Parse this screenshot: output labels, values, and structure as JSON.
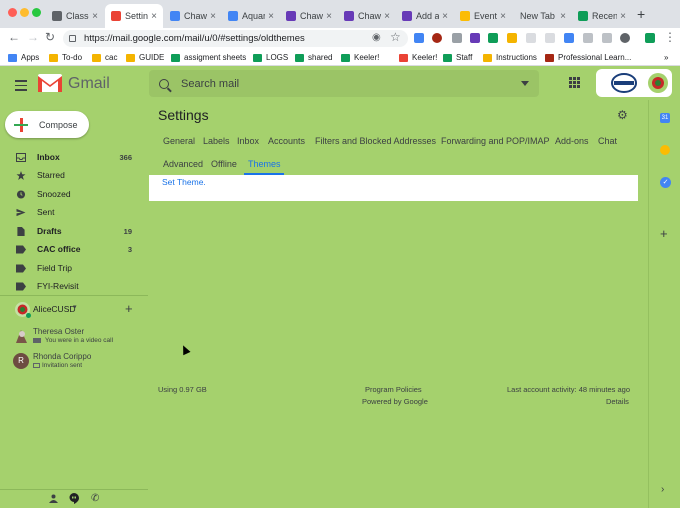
{
  "browser": {
    "tabs": [
      {
        "label": "Classes",
        "icon": "google-classroom-icon",
        "color": "#5f6368"
      },
      {
        "label": "Settings",
        "icon": "gmail-icon",
        "color": "#ea4335",
        "active": true
      },
      {
        "label": "Chawa",
        "icon": "calendar-icon",
        "color": "#4285f4"
      },
      {
        "label": "Aquar",
        "icon": "docs-icon",
        "color": "#4285f4"
      },
      {
        "label": "Chawa",
        "icon": "forms-icon",
        "color": "#673ab7"
      },
      {
        "label": "Chawa",
        "icon": "forms-icon",
        "color": "#673ab7"
      },
      {
        "label": "Add a",
        "icon": "forms-icon",
        "color": "#673ab7"
      },
      {
        "label": "Events",
        "icon": "pen-icon",
        "color": "#fbbc04"
      },
      {
        "label": "New Tab",
        "icon": "",
        "color": ""
      },
      {
        "label": "Recen",
        "icon": "drive-icon",
        "color": "#0f9d58"
      }
    ],
    "url": "https://mail.google.com/mail/u/0/#settings/oldthemes",
    "bookmarks": [
      {
        "label": "Apps",
        "color": "#4285f4"
      },
      {
        "label": "To-do",
        "color": "#f4b400"
      },
      {
        "label": "cac",
        "color": "#f4b400"
      },
      {
        "label": "GUIDE",
        "color": "#f4b400"
      },
      {
        "label": "assigment sheets",
        "color": "#0f9d58"
      },
      {
        "label": "LOGS",
        "color": "#0f9d58"
      },
      {
        "label": "shared",
        "color": "#0f9d58"
      },
      {
        "label": "Keeler!",
        "color": "#0f9d58"
      },
      {
        "label": "Keeler!",
        "color": "#ea4335"
      },
      {
        "label": "Staff",
        "color": "#0f9d58"
      },
      {
        "label": "Instructions",
        "color": "#f4b400"
      },
      {
        "label": "Professional Learn...",
        "color": "#a52714"
      }
    ]
  },
  "gmail": {
    "logo_text": "Gmail",
    "search_placeholder": "Search mail",
    "compose_label": "Compose",
    "nav": [
      {
        "label": "Inbox",
        "count": "366",
        "bold": true,
        "icon": "inbox-icon"
      },
      {
        "label": "Starred",
        "count": "",
        "bold": false,
        "icon": "star-icon"
      },
      {
        "label": "Snoozed",
        "count": "",
        "bold": false,
        "icon": "clock-icon"
      },
      {
        "label": "Sent",
        "count": "",
        "bold": false,
        "icon": "send-icon"
      },
      {
        "label": "Drafts",
        "count": "19",
        "bold": true,
        "icon": "draft-icon"
      },
      {
        "label": "CAC office",
        "count": "3",
        "bold": true,
        "icon": "label-icon"
      },
      {
        "label": "Field Trip",
        "count": "",
        "bold": false,
        "icon": "label-icon"
      },
      {
        "label": "FYI-Revisit",
        "count": "",
        "bold": false,
        "icon": "label-icon"
      }
    ],
    "hangouts": {
      "user": "AliceCUSD",
      "contacts": [
        {
          "name": "Theresa Oster",
          "status": "You were in a video call"
        },
        {
          "name": "Rhonda Corippo",
          "status": "Invitation sent",
          "initial": "R"
        }
      ]
    },
    "settings": {
      "title": "Settings",
      "tabs_row1": [
        "General",
        "Labels",
        "Inbox",
        "Accounts",
        "Filters and Blocked Addresses",
        "Forwarding and POP/IMAP",
        "Add-ons",
        "Chat"
      ],
      "tabs_row2": [
        "Advanced",
        "Offline",
        "Themes"
      ],
      "active_tab": "Themes",
      "set_theme_link": "Set Theme."
    },
    "footer": {
      "storage": "Using 0.97 GB",
      "program_policies": "Program Policies",
      "powered_by": "Powered by Google",
      "last_activity": "Last account activity: 48 minutes ago",
      "details": "Details"
    },
    "theme_color": "#a5d16d"
  }
}
